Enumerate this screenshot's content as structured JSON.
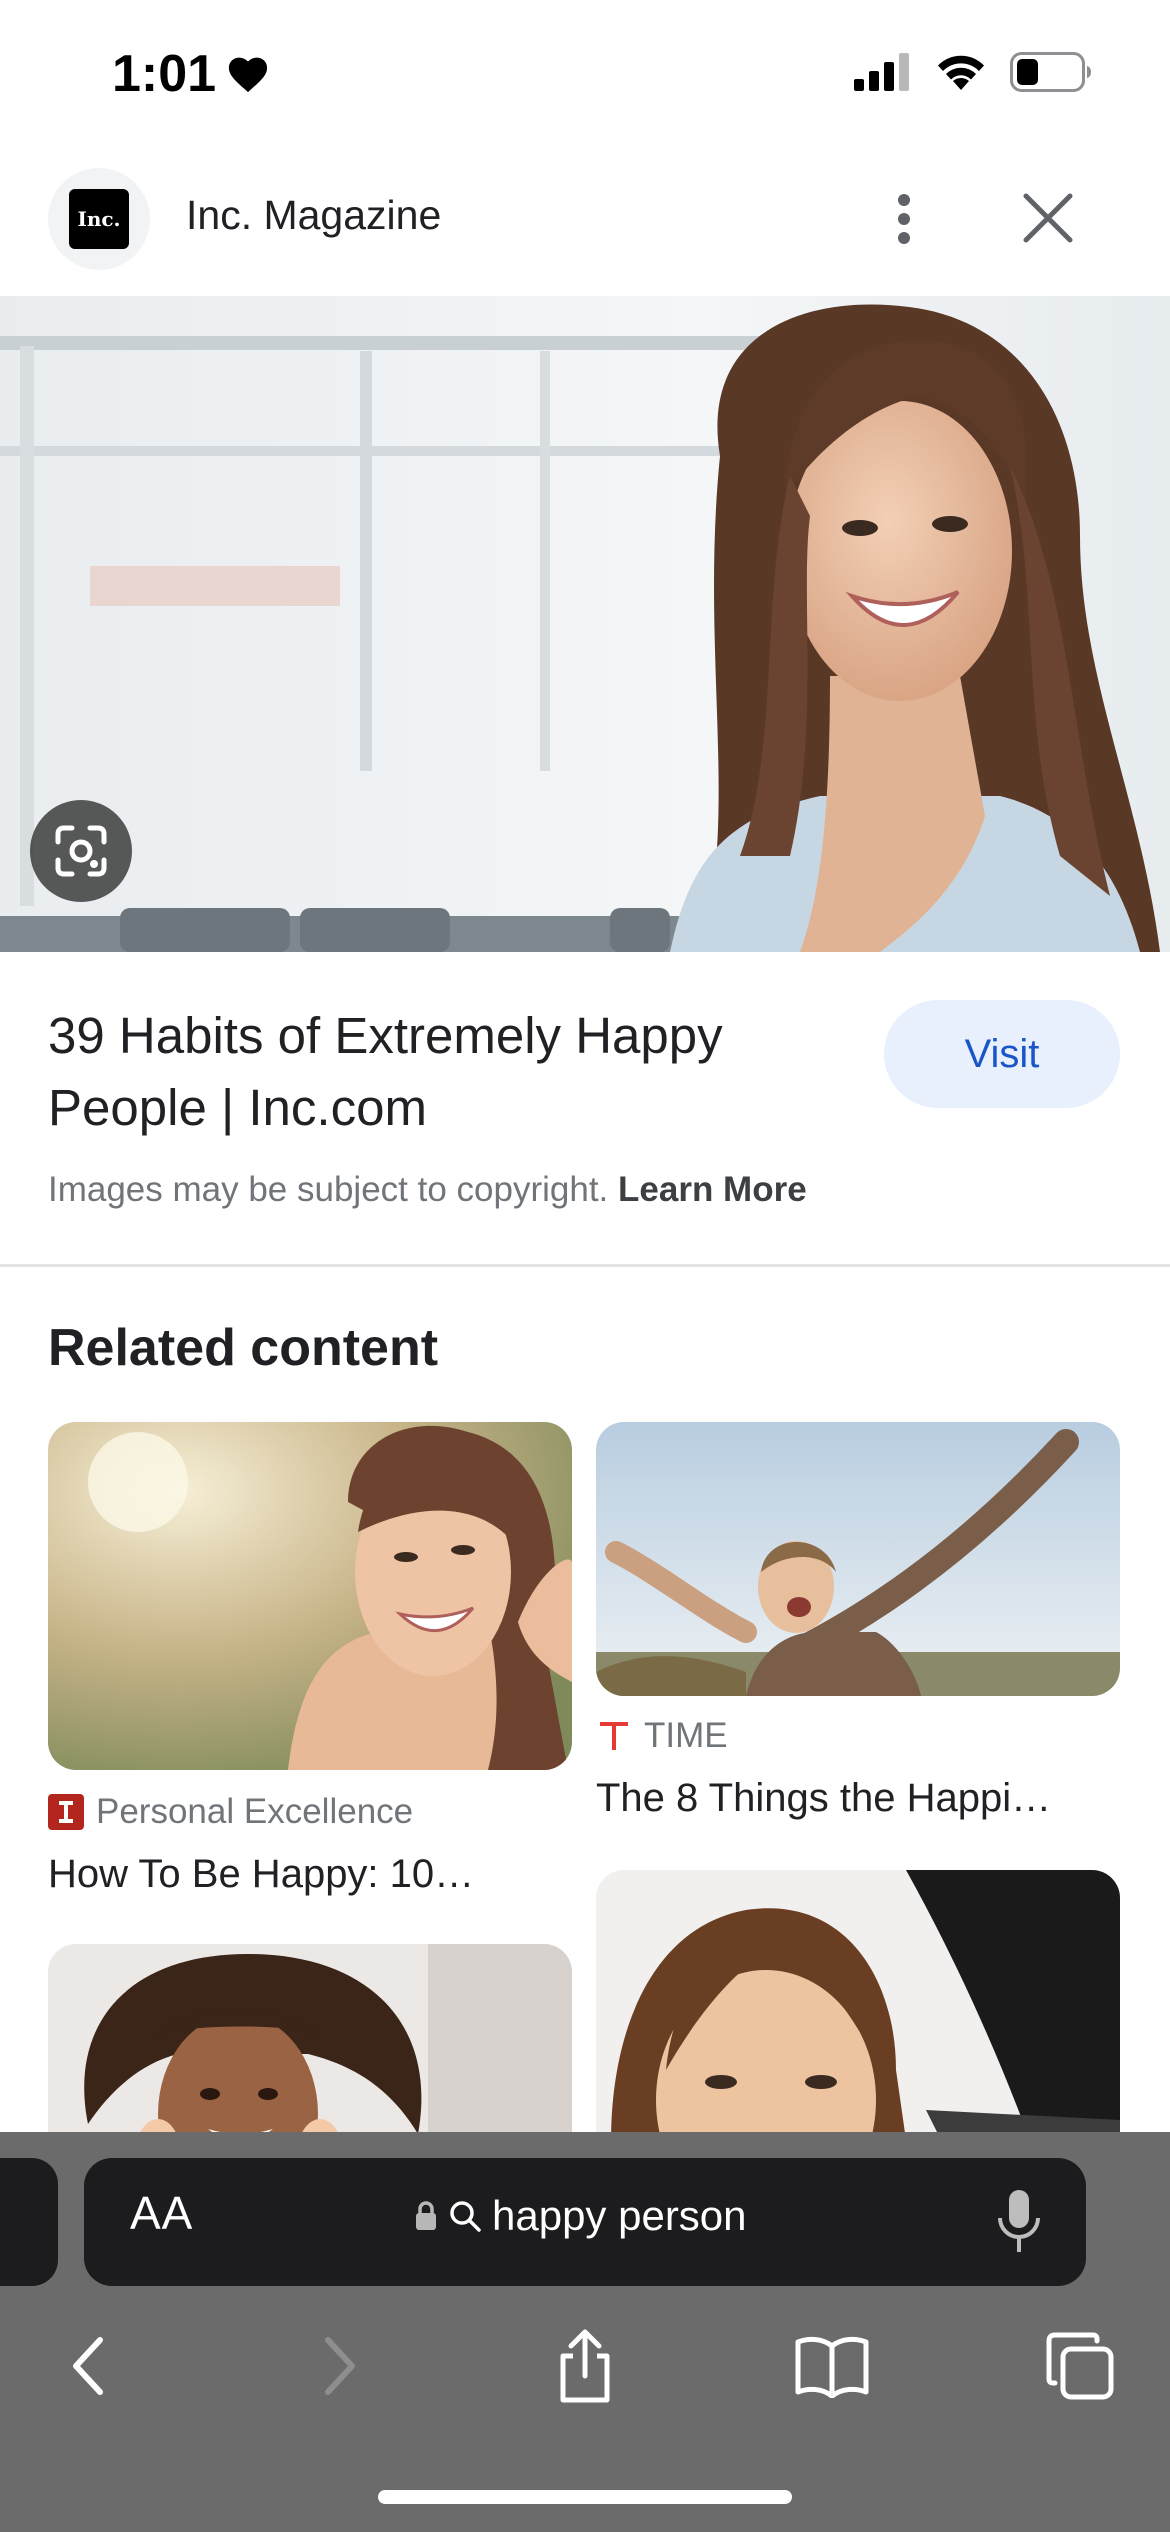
{
  "status_bar": {
    "time": "1:01",
    "battery_level": 0.35
  },
  "header": {
    "publisher_logo_text": "Inc.",
    "publisher_name": "Inc. Magazine"
  },
  "result": {
    "title": "39 Habits of Extremely Happy People | Inc.com",
    "visit_label": "Visit",
    "copyright_text": "Images may be subject to copyright.",
    "learn_more_label": "Learn More"
  },
  "related": {
    "heading": "Related content",
    "items": [
      {
        "source": "Personal Excellence",
        "title": "How To Be Happy: 10…"
      },
      {
        "source": "TIME",
        "title": "The 8 Things the Happi…"
      }
    ]
  },
  "browser": {
    "aa_label": "AA",
    "url_text": "happy person"
  },
  "colors": {
    "visit_bg": "#e8f0fe",
    "visit_text": "#1a56c8",
    "toolbar_bg": "#6b6b6b",
    "url_bar_bg": "#1c1c1e",
    "personal_excellence_logo": "#b3261e",
    "time_logo": "#e53935"
  }
}
